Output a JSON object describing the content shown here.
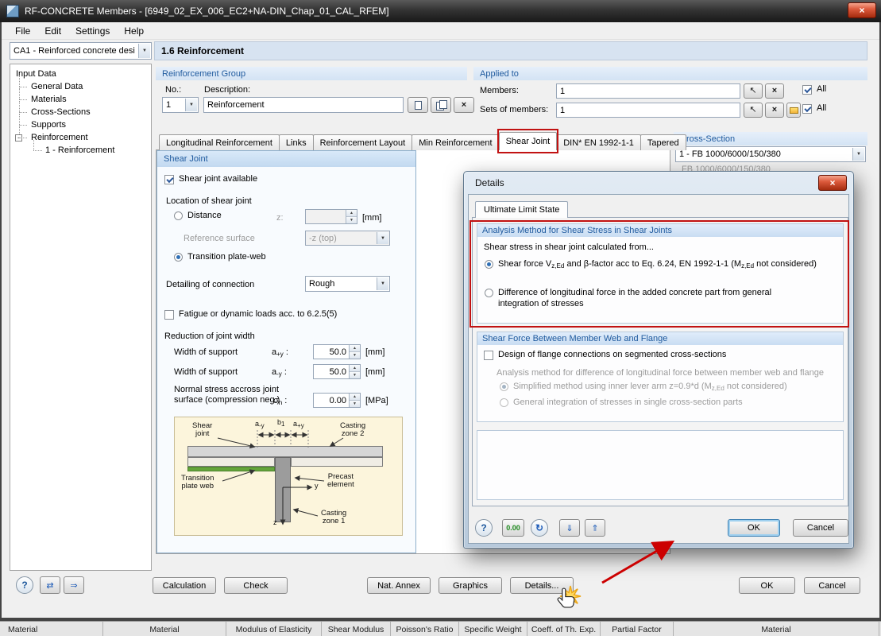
{
  "titlebar": {
    "title": "RF-CONCRETE Members - [6949_02_EX_006_EC2+NA-DIN_Chap_01_CAL_RFEM]"
  },
  "menubar": {
    "items": [
      "File",
      "Edit",
      "Settings",
      "Help"
    ]
  },
  "topbar": {
    "case_selector": "CA1 - Reinforced concrete desi",
    "page_title": "1.6 Reinforcement"
  },
  "sidebar": {
    "root": "Input Data",
    "items": [
      "General Data",
      "Materials",
      "Cross-Sections",
      "Supports",
      "Reinforcement"
    ],
    "child": "1 - Reinforcement"
  },
  "reinforcement_group": {
    "header": "Reinforcement Group",
    "no_label": "No.:",
    "no_value": "1",
    "description_label": "Description:",
    "description_value": "Reinforcement"
  },
  "applied_to": {
    "header": "Applied to",
    "members_label": "Members:",
    "members_value": "1",
    "sets_label": "Sets of members:",
    "sets_value": "1",
    "all_label": "All"
  },
  "tabs": {
    "items": [
      "Longitudinal Reinforcement",
      "Links",
      "Reinforcement Layout",
      "Min Reinforcement",
      "Shear Joint",
      "DIN* EN 1992-1-1",
      "Tapered"
    ],
    "active": "Shear Joint"
  },
  "cross_section": {
    "header": "Cross-Section",
    "selected": "1 - FB 1000/6000/150/380",
    "preview": "FB 1000/6000/150/380"
  },
  "shear_joint": {
    "header": "Shear Joint",
    "available": "Shear joint available",
    "location": "Location of shear joint",
    "distance": "Distance",
    "z_label": "z:",
    "z_value": "",
    "unit_mm": "[mm]",
    "reference_label": "Reference surface",
    "reference_value": "-z (top)",
    "transition": "Transition plate-web",
    "detailing_label": "Detailing of connection",
    "detailing_value": "Rough",
    "fatigue": "Fatigue or dynamic loads acc. to 6.2.5(5)",
    "reduction": "Reduction of joint width",
    "width_support": "Width of support",
    "sym_apy": [
      "a",
      "+y",
      " :"
    ],
    "sym_amy": [
      "a",
      "-y",
      " :"
    ],
    "width_value": "50.0",
    "normal_line1": "Normal stress accross joint",
    "normal_line2": "surface (compression neg.)",
    "sym_sigma": [
      "σ",
      "n",
      " :"
    ],
    "normal_value": "0.00",
    "unit_mpa": "[MPa]"
  },
  "diagram": {
    "shear_joint": "Shear\njoint",
    "casting2": "Casting\nzone 2",
    "transition": "Transition\nplate web",
    "precast": "Precast\nelement",
    "casting1": "Casting\nzone 1",
    "dim_amy": [
      "a",
      "-y"
    ],
    "dim_b": [
      "b",
      "1"
    ],
    "dim_apy": [
      "a",
      "+y"
    ],
    "axis_y": "y",
    "axis_z": "z"
  },
  "details_dialog": {
    "title": "Details",
    "tab": "Ultimate Limit State",
    "shear_section": {
      "header": "Analysis Method for Shear Stress in Shear Joints",
      "intro": "Shear stress in shear joint calculated from...",
      "option1": [
        "Shear force V",
        "z,Ed",
        " and β-factor acc to Eq. 6.24, EN 1992-1-1 (M",
        "z,Ed",
        " not considered)"
      ],
      "option2": "Difference of longitudinal force in the added concrete part from general integration of stresses"
    },
    "flange_section": {
      "header": "Shear Force Between Member Web and Flange",
      "checkbox": "Design of flange connections on segmented cross-sections",
      "description": "Analysis method for difference of longitudinal force between member web and flange",
      "option1": [
        "Simplified method using inner lever arm z=0.9*d (M",
        "z,Ed",
        " not considered)"
      ],
      "option2": "General integration of stresses in single cross-section parts"
    },
    "zero_button": "0.00",
    "ok": "OK",
    "cancel": "Cancel"
  },
  "footer": {
    "calculation": "Calculation",
    "check": "Check",
    "nat_annex": "Nat. Annex",
    "graphics": "Graphics",
    "details": "Details...",
    "ok": "OK",
    "cancel": "Cancel"
  },
  "background_table": {
    "headers": [
      "Material",
      "Material",
      "Modulus of Elasticity",
      "Shear Modulus",
      "Poisson's Ratio",
      "Specific Weight",
      "Coeff. of Th. Exp.",
      "Partial Factor",
      "Material"
    ]
  },
  "icons": {
    "close": "×",
    "dropdown": "▼",
    "spin_up": "▲",
    "spin_down": "▼",
    "delete": "×",
    "pick": "↖",
    "help": "?",
    "refresh": "↻",
    "import": "⇓",
    "export": "⇑",
    "nav_graphic": "⇄",
    "nav_jump": "⇒",
    "collapse": "-"
  },
  "colors": {
    "annotation_red": "#c11212",
    "header_blue": "#1f5a9e",
    "ok_focus_blue": "#3c7fb1"
  }
}
